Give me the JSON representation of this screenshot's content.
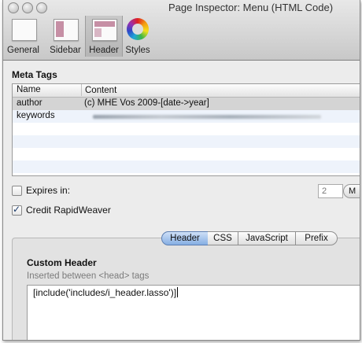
{
  "window": {
    "title": "Page Inspector: Menu (HTML Code)"
  },
  "toolbar": {
    "items": [
      {
        "label": "General",
        "icon": "general-page-icon"
      },
      {
        "label": "Sidebar",
        "icon": "sidebar-layout-icon"
      },
      {
        "label": "Header",
        "icon": "header-layout-icon",
        "selected": true
      },
      {
        "label": "Styles",
        "icon": "color-wheel-icon"
      }
    ]
  },
  "meta_tags": {
    "section_label": "Meta Tags",
    "columns": [
      "Name",
      "Content"
    ],
    "rows": [
      {
        "name": "author",
        "content": "(c) MHE Vos 2009-[date->year]"
      },
      {
        "name": "keywords",
        "content": ""
      }
    ]
  },
  "options": {
    "expires_label": "Expires in:",
    "expires_checked": false,
    "expires_value": "2",
    "unit_label": "M",
    "credit_label": "Credit RapidWeaver",
    "credit_checked": true
  },
  "tabs": {
    "items": [
      "Header",
      "CSS",
      "JavaScript",
      "Prefix"
    ],
    "active": "Header"
  },
  "custom_header": {
    "title": "Custom Header",
    "subtitle": "Inserted between <head> tags",
    "code": "[include('includes/i_header.lasso')]"
  },
  "colors": {
    "accent": "#86aee3",
    "selected_row": "#d4d4d4",
    "alt_row": "#eef3fb"
  }
}
